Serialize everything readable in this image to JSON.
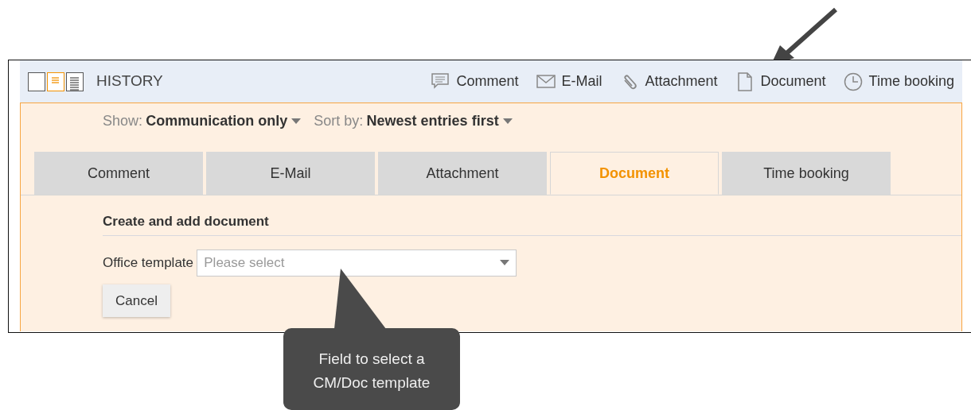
{
  "history": {
    "title": "HISTORY",
    "view_modes": [
      {
        "selected": false
      },
      {
        "selected": true
      },
      {
        "selected": false
      }
    ],
    "actions": [
      {
        "label": "Comment",
        "kind": "comment"
      },
      {
        "label": "E-Mail",
        "kind": "mail"
      },
      {
        "label": "Attachment",
        "kind": "attachment"
      },
      {
        "label": "Document",
        "kind": "document"
      },
      {
        "label": "Time booking",
        "kind": "clock"
      }
    ]
  },
  "filters": [
    {
      "label": "Show:",
      "value": "Communication only"
    },
    {
      "label": "Sort by:",
      "value": "Newest entries first"
    }
  ],
  "tabs": [
    {
      "label": "Comment",
      "selected": false
    },
    {
      "label": "E-Mail",
      "selected": false
    },
    {
      "label": "Attachment",
      "selected": false
    },
    {
      "label": "Document",
      "selected": true
    },
    {
      "label": "Time booking",
      "selected": false
    }
  ],
  "form": {
    "heading": "Create and add document",
    "field_label": "Office template",
    "placeholder": "Please select",
    "button": "Cancel"
  },
  "callout": {
    "text": "Field to select a CM/Doc template"
  }
}
